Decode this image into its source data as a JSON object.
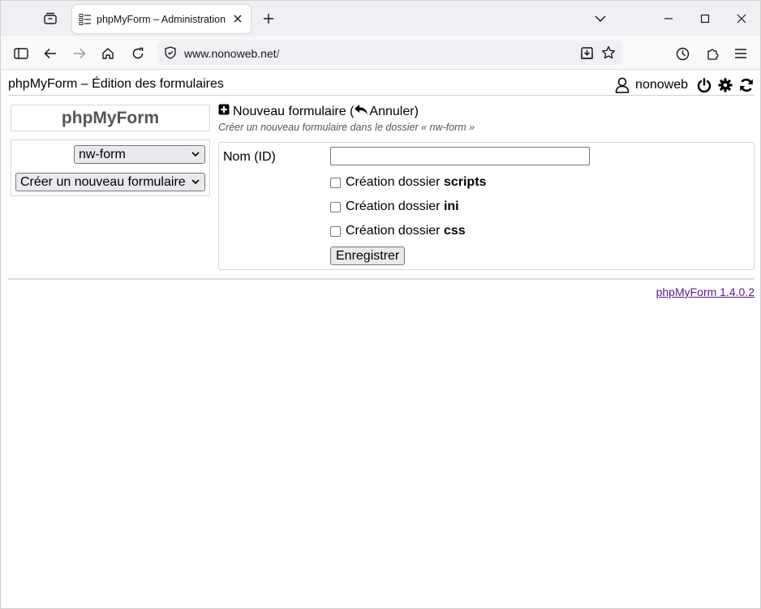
{
  "browser": {
    "tab": {
      "title": "phpMyForm – Administration"
    },
    "url": {
      "domain": "www.nonoweb.net",
      "path": "/"
    }
  },
  "header": {
    "title": "phpMyForm – Édition des formulaires",
    "user": "nonoweb"
  },
  "sidebar": {
    "logo": "phpMyForm",
    "folder_select": "nw-form",
    "action_select": "Créer un nouveau formulaire"
  },
  "form": {
    "title_main": "Nouveau formulaire (",
    "cancel_label": "Annuler",
    "title_close": ")",
    "subtitle": "Créer un nouveau formulaire dans le dossier « nw-form »",
    "name_label": "Nom (ID)",
    "name_value": "",
    "checkbox_prefix": "Création dossier",
    "checkboxes": [
      {
        "label": "scripts",
        "checked": false
      },
      {
        "label": "ini",
        "checked": false
      },
      {
        "label": "css",
        "checked": false
      }
    ],
    "save_label": "Enregistrer"
  },
  "footer": {
    "version": "phpMyForm 1.4.0.2"
  }
}
